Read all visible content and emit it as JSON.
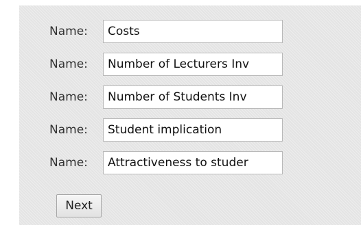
{
  "form": {
    "fields": [
      {
        "label": "Name:",
        "value": "Costs"
      },
      {
        "label": "Name:",
        "value": "Number of Lecturers Inv"
      },
      {
        "label": "Name:",
        "value": "Number of Students Inv"
      },
      {
        "label": "Name:",
        "value": "Student implication"
      },
      {
        "label": "Name:",
        "value": "Attractiveness to studer"
      }
    ],
    "next_label": "Next"
  }
}
